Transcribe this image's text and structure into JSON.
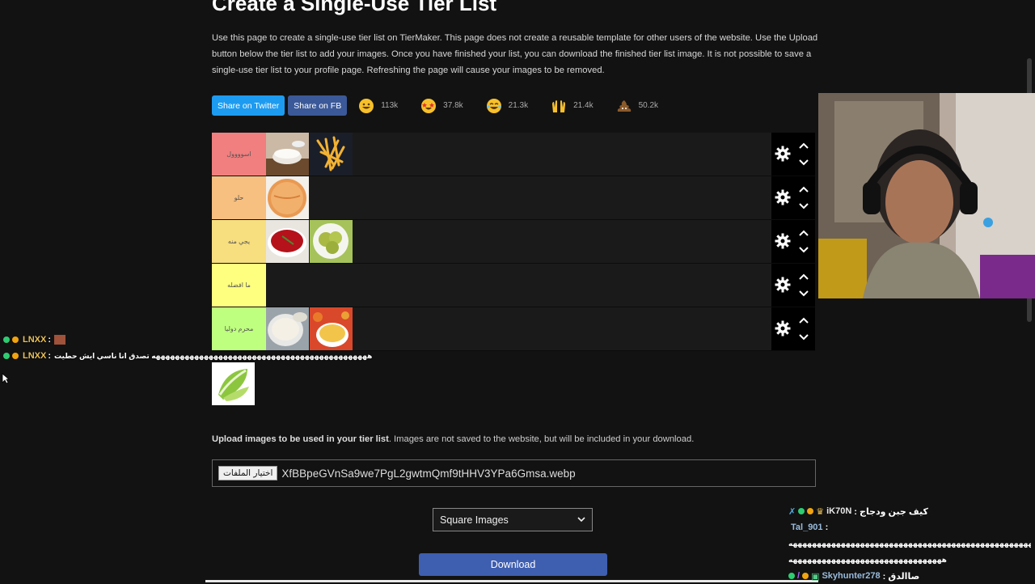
{
  "page": {
    "title": "Create a Single-Use Tier List",
    "intro": "Use this page to create a single-use tier list on TierMaker. This page does not create a reusable template for other users of the website. Use the Upload button below the tier list to add your images. Once you have finished your list, you can download the finished tier list image. It is not possible to save a single-use tier list to your profile page. Refreshing the page will cause your images to be removed."
  },
  "share": {
    "twitter": "Share on Twitter",
    "facebook": "Share on FB"
  },
  "reactions": [
    {
      "icon": "grinning-face-icon",
      "count": "113k"
    },
    {
      "icon": "star-struck-face-icon",
      "count": "37.8k"
    },
    {
      "icon": "laughing-tears-face-icon",
      "count": "21.3k"
    },
    {
      "icon": "raised-hands-icon",
      "count": "21.4k"
    },
    {
      "icon": "poop-icon",
      "count": "50.2k"
    }
  ],
  "tiers": [
    {
      "label": "اسوووول",
      "color": "#f17f7f",
      "items": [
        "sauce-bowl",
        "fries"
      ]
    },
    {
      "label": "حلو",
      "color": "#f7bf80",
      "items": [
        "burger-sauce"
      ]
    },
    {
      "label": "يجي منه",
      "color": "#f7de7f",
      "items": [
        "ketchup",
        "pickles"
      ]
    },
    {
      "label": "ما افضله",
      "color": "#feff7f",
      "items": []
    },
    {
      "label": "محرم دوليا",
      "color": "#bfff7f",
      "items": [
        "garlic-sauce",
        "cheese-sauce"
      ]
    }
  ],
  "pool": [
    "lettuce"
  ],
  "overlay_chat": [
    {
      "user": "LNXX",
      "message": ""
    },
    {
      "user": "LNXX",
      "message": "هههههههههههههههههههههههههههههههههههههههههههههه تصدق انا ناسي ايش حطيت"
    }
  ],
  "upload": {
    "bold": "Upload images to be used in your tier list",
    "text": ". Images are not saved to the website, but will be included in your download.",
    "button": "اختيار الملفات",
    "filename": "XfBBpeGVnSa9we7PgL2gwtmQmf9tHHV3YPa6Gmsa.webp"
  },
  "image_mode": "Square Images",
  "download": "Download",
  "stream_chat": [
    {
      "user": "iK70N",
      "message": ": كيف جبن ودجاج"
    },
    {
      "user": "Tal_901",
      "message": ":"
    },
    {
      "user": "",
      "message": "ههههههههههههههههههههههههههههههههههههههههههههههههههههههههه"
    },
    {
      "user": "",
      "message": "ههههههههههههههههههههههههههههههههه"
    },
    {
      "user": "Skyhunter278",
      "message": ": صاالدق"
    }
  ]
}
